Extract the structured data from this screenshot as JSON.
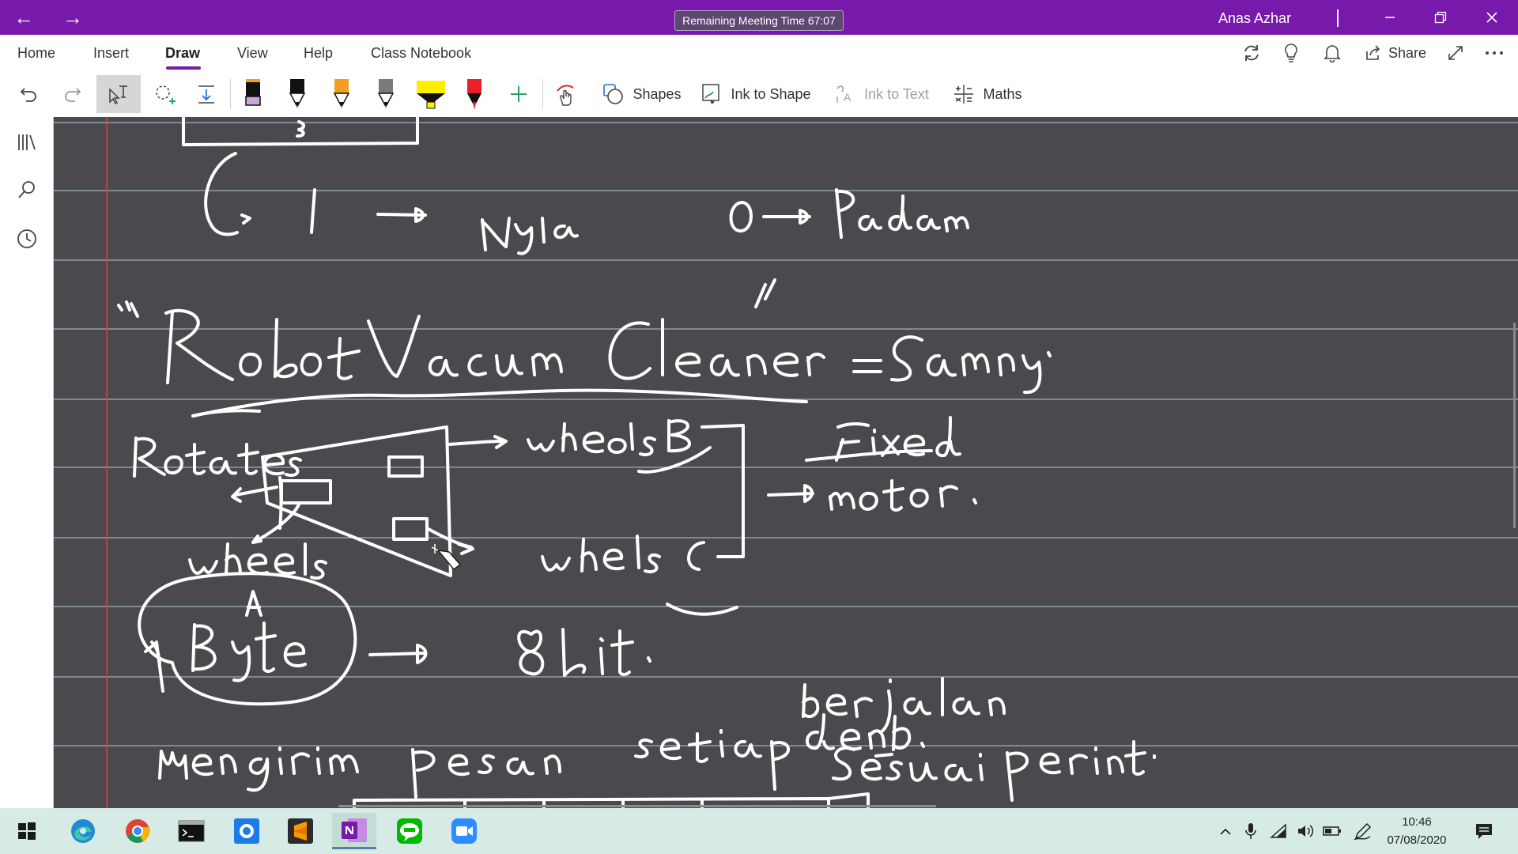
{
  "titlebar": {
    "center_text": "Remaining Meeting Time 67:07",
    "user_name": "Anas Azhar"
  },
  "tabs": [
    {
      "label": "Home"
    },
    {
      "label": "Insert"
    },
    {
      "label": "Draw",
      "active": true
    },
    {
      "label": "View"
    },
    {
      "label": "Help"
    },
    {
      "label": "Class Notebook"
    }
  ],
  "ribbon_right": {
    "share_label": "Share"
  },
  "draw_toolbar": {
    "shapes_label": "Shapes",
    "ink_to_shape_label": "Ink to Shape",
    "ink_to_text_label": "Ink to Text",
    "maths_label": "Maths"
  },
  "pens": [
    {
      "name": "pen-black-lavender",
      "body": "#111111",
      "tip": "#c9a8d9"
    },
    {
      "name": "pen-black",
      "body": "#111111",
      "tip": "#111111"
    },
    {
      "name": "pen-orange",
      "body": "#f0a020",
      "tip": "#111111"
    },
    {
      "name": "pen-gray",
      "body": "#7a7a7a",
      "tip": "#111111"
    },
    {
      "name": "highlighter-yellow",
      "body": "#ffee00",
      "tip": "#ffee00"
    },
    {
      "name": "pen-red",
      "body": "#e8202a",
      "tip": "#111111"
    }
  ],
  "colors": {
    "accent": "#7719aa",
    "canvas": "#4a4a4e",
    "rule_line": "#a9c3d3",
    "margin_line": "#d2464a",
    "ink": "#ffffff"
  },
  "taskbar": {
    "time": "10:46",
    "date": "07/08/2020"
  }
}
